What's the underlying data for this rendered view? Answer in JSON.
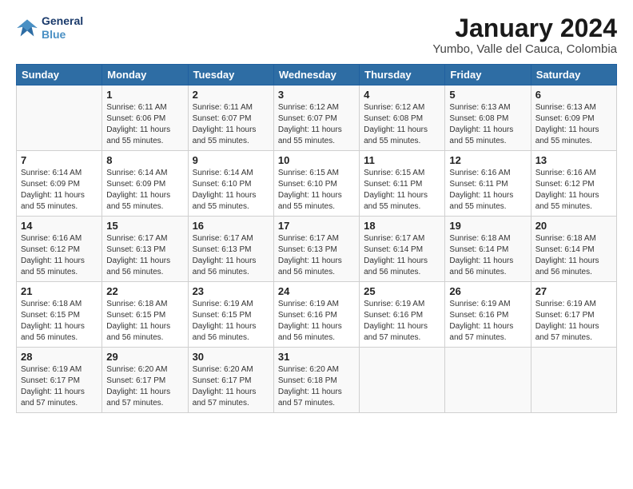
{
  "logo": {
    "line1": "General",
    "line2": "Blue"
  },
  "title": "January 2024",
  "location": "Yumbo, Valle del Cauca, Colombia",
  "days_of_week": [
    "Sunday",
    "Monday",
    "Tuesday",
    "Wednesday",
    "Thursday",
    "Friday",
    "Saturday"
  ],
  "weeks": [
    [
      {
        "day": "",
        "info": ""
      },
      {
        "day": "1",
        "info": "Sunrise: 6:11 AM\nSunset: 6:06 PM\nDaylight: 11 hours\nand 55 minutes."
      },
      {
        "day": "2",
        "info": "Sunrise: 6:11 AM\nSunset: 6:07 PM\nDaylight: 11 hours\nand 55 minutes."
      },
      {
        "day": "3",
        "info": "Sunrise: 6:12 AM\nSunset: 6:07 PM\nDaylight: 11 hours\nand 55 minutes."
      },
      {
        "day": "4",
        "info": "Sunrise: 6:12 AM\nSunset: 6:08 PM\nDaylight: 11 hours\nand 55 minutes."
      },
      {
        "day": "5",
        "info": "Sunrise: 6:13 AM\nSunset: 6:08 PM\nDaylight: 11 hours\nand 55 minutes."
      },
      {
        "day": "6",
        "info": "Sunrise: 6:13 AM\nSunset: 6:09 PM\nDaylight: 11 hours\nand 55 minutes."
      }
    ],
    [
      {
        "day": "7",
        "info": "Sunrise: 6:14 AM\nSunset: 6:09 PM\nDaylight: 11 hours\nand 55 minutes."
      },
      {
        "day": "8",
        "info": "Sunrise: 6:14 AM\nSunset: 6:09 PM\nDaylight: 11 hours\nand 55 minutes."
      },
      {
        "day": "9",
        "info": "Sunrise: 6:14 AM\nSunset: 6:10 PM\nDaylight: 11 hours\nand 55 minutes."
      },
      {
        "day": "10",
        "info": "Sunrise: 6:15 AM\nSunset: 6:10 PM\nDaylight: 11 hours\nand 55 minutes."
      },
      {
        "day": "11",
        "info": "Sunrise: 6:15 AM\nSunset: 6:11 PM\nDaylight: 11 hours\nand 55 minutes."
      },
      {
        "day": "12",
        "info": "Sunrise: 6:16 AM\nSunset: 6:11 PM\nDaylight: 11 hours\nand 55 minutes."
      },
      {
        "day": "13",
        "info": "Sunrise: 6:16 AM\nSunset: 6:12 PM\nDaylight: 11 hours\nand 55 minutes."
      }
    ],
    [
      {
        "day": "14",
        "info": "Sunrise: 6:16 AM\nSunset: 6:12 PM\nDaylight: 11 hours\nand 55 minutes."
      },
      {
        "day": "15",
        "info": "Sunrise: 6:17 AM\nSunset: 6:13 PM\nDaylight: 11 hours\nand 56 minutes."
      },
      {
        "day": "16",
        "info": "Sunrise: 6:17 AM\nSunset: 6:13 PM\nDaylight: 11 hours\nand 56 minutes."
      },
      {
        "day": "17",
        "info": "Sunrise: 6:17 AM\nSunset: 6:13 PM\nDaylight: 11 hours\nand 56 minutes."
      },
      {
        "day": "18",
        "info": "Sunrise: 6:17 AM\nSunset: 6:14 PM\nDaylight: 11 hours\nand 56 minutes."
      },
      {
        "day": "19",
        "info": "Sunrise: 6:18 AM\nSunset: 6:14 PM\nDaylight: 11 hours\nand 56 minutes."
      },
      {
        "day": "20",
        "info": "Sunrise: 6:18 AM\nSunset: 6:14 PM\nDaylight: 11 hours\nand 56 minutes."
      }
    ],
    [
      {
        "day": "21",
        "info": "Sunrise: 6:18 AM\nSunset: 6:15 PM\nDaylight: 11 hours\nand 56 minutes."
      },
      {
        "day": "22",
        "info": "Sunrise: 6:18 AM\nSunset: 6:15 PM\nDaylight: 11 hours\nand 56 minutes."
      },
      {
        "day": "23",
        "info": "Sunrise: 6:19 AM\nSunset: 6:15 PM\nDaylight: 11 hours\nand 56 minutes."
      },
      {
        "day": "24",
        "info": "Sunrise: 6:19 AM\nSunset: 6:16 PM\nDaylight: 11 hours\nand 56 minutes."
      },
      {
        "day": "25",
        "info": "Sunrise: 6:19 AM\nSunset: 6:16 PM\nDaylight: 11 hours\nand 57 minutes."
      },
      {
        "day": "26",
        "info": "Sunrise: 6:19 AM\nSunset: 6:16 PM\nDaylight: 11 hours\nand 57 minutes."
      },
      {
        "day": "27",
        "info": "Sunrise: 6:19 AM\nSunset: 6:17 PM\nDaylight: 11 hours\nand 57 minutes."
      }
    ],
    [
      {
        "day": "28",
        "info": "Sunrise: 6:19 AM\nSunset: 6:17 PM\nDaylight: 11 hours\nand 57 minutes."
      },
      {
        "day": "29",
        "info": "Sunrise: 6:20 AM\nSunset: 6:17 PM\nDaylight: 11 hours\nand 57 minutes."
      },
      {
        "day": "30",
        "info": "Sunrise: 6:20 AM\nSunset: 6:17 PM\nDaylight: 11 hours\nand 57 minutes."
      },
      {
        "day": "31",
        "info": "Sunrise: 6:20 AM\nSunset: 6:18 PM\nDaylight: 11 hours\nand 57 minutes."
      },
      {
        "day": "",
        "info": ""
      },
      {
        "day": "",
        "info": ""
      },
      {
        "day": "",
        "info": ""
      }
    ]
  ]
}
